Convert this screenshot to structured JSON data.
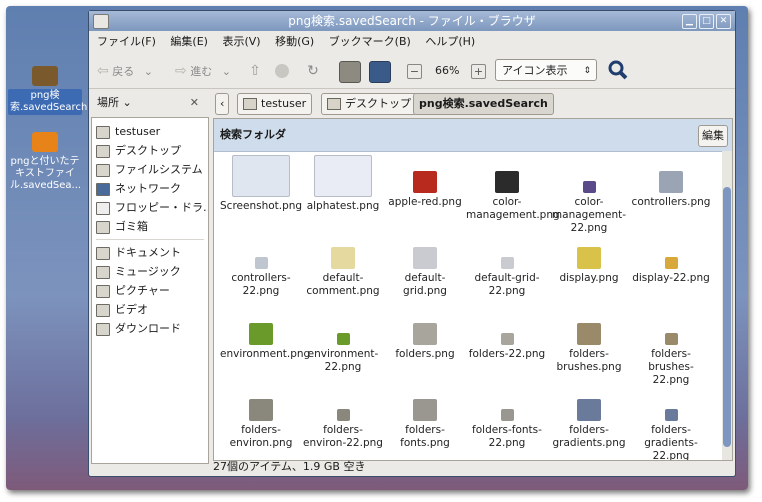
{
  "desktop": {
    "icons": [
      {
        "label": "png検索.savedSearch",
        "color": "#7a5a2c",
        "selected": true
      },
      {
        "label": "pngと付いたテキストファイル.savedSea...",
        "color": "#e8831a",
        "selected": false
      }
    ]
  },
  "window": {
    "title": "png検索.savedSearch - ファイル・ブラウザ",
    "menu": [
      "ファイル(F)",
      "編集(E)",
      "表示(V)",
      "移動(G)",
      "ブックマーク(B)",
      "ヘルプ(H)"
    ],
    "toolbar": {
      "back_label": "戻る",
      "forward_label": "進む",
      "zoom_level": "66%",
      "view_mode": "アイコン表示"
    },
    "sidebar": {
      "header": "場所",
      "places": [
        "testuser",
        "デスクトップ",
        "ファイルシステム",
        "ネットワーク",
        "フロッピー・ドラ…",
        "ゴミ箱"
      ],
      "bookmarks": [
        "ドキュメント",
        "ミュージック",
        "ピクチャー",
        "ビデオ",
        "ダウンロード"
      ]
    },
    "breadcrumbs": [
      "testuser",
      "デスクトップ",
      "png検索.savedSearch"
    ],
    "search_folder_label": "検索フォルダ",
    "edit_button": "編集",
    "files": [
      "Screenshot.png",
      "alphatest.png",
      "apple-red.png",
      "color-management.png",
      "color-management-22.png",
      "controllers.png",
      "controllers-22.png",
      "default-comment.png",
      "default-grid.png",
      "default-grid-22.png",
      "display.png",
      "display-22.png",
      "environment.png",
      "environment-22.png",
      "folders.png",
      "folders-22.png",
      "folders-brushes.png",
      "folders-brushes-22.png",
      "folders-environ.png",
      "folders-environ-22.png",
      "folders-fonts.png",
      "folders-fonts-22.png",
      "folders-gradients.png",
      "folders-gradients-22.png"
    ],
    "status": "27個のアイテム、1.9 GB 空き"
  }
}
